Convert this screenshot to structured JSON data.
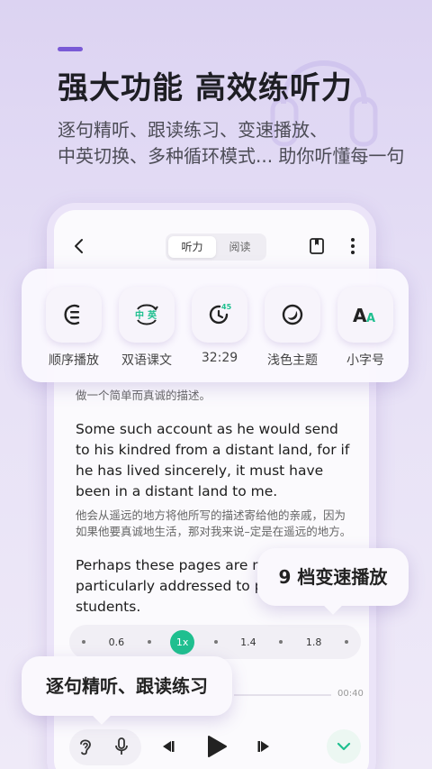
{
  "hero": {
    "title": "强大功能 高效练听力",
    "subtitle_line1": "逐句精听、跟读练习、变速播放、",
    "subtitle_line2": "中英切换、多种循环模式... 助你听懂每一句"
  },
  "app": {
    "tabs": [
      {
        "label": "听力",
        "active": true
      },
      {
        "label": "阅读",
        "active": false
      }
    ],
    "features": [
      {
        "label": "顺序播放",
        "icon": "sequence-play-icon"
      },
      {
        "label": "双语课文",
        "icon": "bilingual-icon",
        "icon_text_cn": "中",
        "icon_text_en": "英"
      },
      {
        "label": "32:29",
        "icon": "timer-icon",
        "icon_badge": "45"
      },
      {
        "label": "浅色主题",
        "icon": "theme-icon"
      },
      {
        "label": "小字号",
        "icon": "font-size-icon",
        "icon_text_a1": "A",
        "icon_text_a2": "A"
      }
    ],
    "content": {
      "cn_first": "做一个简单而真诚的描述。",
      "en_para1": "Some such account as he would send to his kindred from a distant land, for if he has lived sincerely, it must have been in a distant land to me.",
      "cn_para1": "他会从遥远的地方将他所写的描述寄给他的亲戚，因为如果他要真诚地生活，那对我来说–定是在遥远的地方。",
      "en_para2": "Perhaps these pages are more particularly addressed to poor students."
    },
    "speeds": [
      "0.6",
      "1x",
      "1.4",
      "1.8"
    ],
    "active_speed": "1x",
    "time_end": "00:40"
  },
  "tooltips": {
    "speed": "9 档变速播放",
    "practice": "逐句精听、跟读练习"
  },
  "colors": {
    "accent": "#7a5ad6",
    "green": "#1fbf8f",
    "background": "#e2daf4"
  }
}
